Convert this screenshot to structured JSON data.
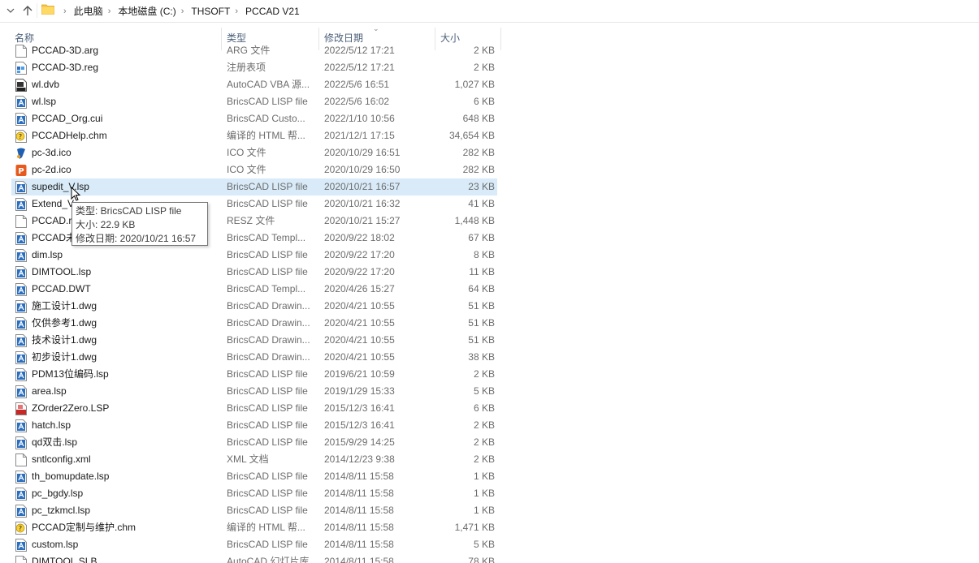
{
  "address": {
    "crumbs": [
      "此电脑",
      "本地磁盘 (C:)",
      "THSOFT",
      "PCCAD V21"
    ]
  },
  "columns": {
    "name": "名称",
    "type": "类型",
    "date": "修改日期",
    "size": "大小"
  },
  "files": [
    {
      "name": "PCCAD-3D.arg",
      "type": "ARG 文件",
      "date": "2022/5/12 17:21",
      "size": "2 KB",
      "icon": "generic-file-icon"
    },
    {
      "name": "PCCAD-3D.reg",
      "type": "注册表项",
      "date": "2022/5/12 17:21",
      "size": "2 KB",
      "icon": "registry-icon"
    },
    {
      "name": "wl.dvb",
      "type": "AutoCAD VBA 源...",
      "date": "2022/5/6 16:51",
      "size": "1,027 KB",
      "icon": "dvb-icon"
    },
    {
      "name": "wl.lsp",
      "type": "BricsCAD LISP file",
      "date": "2022/5/6 16:02",
      "size": "6 KB",
      "icon": "bricscad-icon"
    },
    {
      "name": "PCCAD_Org.cui",
      "type": "BricsCAD Custo...",
      "date": "2022/1/10 10:56",
      "size": "648 KB",
      "icon": "bricscad-icon"
    },
    {
      "name": "PCCADHelp.chm",
      "type": "编译的 HTML 帮...",
      "date": "2021/12/1 17:15",
      "size": "34,654 KB",
      "icon": "chm-help-icon"
    },
    {
      "name": "pc-3d.ico",
      "type": "ICO 文件",
      "date": "2020/10/29 16:51",
      "size": "282 KB",
      "icon": "pc3d-ico-icon"
    },
    {
      "name": "pc-2d.ico",
      "type": "ICO 文件",
      "date": "2020/10/29 16:50",
      "size": "282 KB",
      "icon": "pc2d-ico-icon"
    },
    {
      "name": "supedit_V.lsp",
      "type": "BricsCAD LISP file",
      "date": "2020/10/21 16:57",
      "size": "23 KB",
      "icon": "bricscad-icon",
      "selected": true
    },
    {
      "name": "Extend_V",
      "type": "BricsCAD LISP file",
      "date": "2020/10/21 16:32",
      "size": "41 KB",
      "icon": "bricscad-icon"
    },
    {
      "name": "PCCAD.r",
      "type": "RESZ 文件",
      "date": "2020/10/21 15:27",
      "size": "1,448 KB",
      "icon": "generic-file-icon"
    },
    {
      "name": "PCCAD未",
      "type": "BricsCAD Templ...",
      "date": "2020/9/22 18:02",
      "size": "67 KB",
      "icon": "bricscad-icon"
    },
    {
      "name": "dim.lsp",
      "type": "BricsCAD LISP file",
      "date": "2020/9/22 17:20",
      "size": "8 KB",
      "icon": "bricscad-icon"
    },
    {
      "name": "DIMTOOL.lsp",
      "type": "BricsCAD LISP file",
      "date": "2020/9/22 17:20",
      "size": "11 KB",
      "icon": "bricscad-icon"
    },
    {
      "name": "PCCAD.DWT",
      "type": "BricsCAD Templ...",
      "date": "2020/4/26 15:27",
      "size": "64 KB",
      "icon": "bricscad-icon"
    },
    {
      "name": "施工设计1.dwg",
      "type": "BricsCAD Drawin...",
      "date": "2020/4/21 10:55",
      "size": "51 KB",
      "icon": "bricscad-icon"
    },
    {
      "name": "仅供参考1.dwg",
      "type": "BricsCAD Drawin...",
      "date": "2020/4/21 10:55",
      "size": "51 KB",
      "icon": "bricscad-icon"
    },
    {
      "name": "技术设计1.dwg",
      "type": "BricsCAD Drawin...",
      "date": "2020/4/21 10:55",
      "size": "51 KB",
      "icon": "bricscad-icon"
    },
    {
      "name": "初步设计1.dwg",
      "type": "BricsCAD Drawin...",
      "date": "2020/4/21 10:55",
      "size": "38 KB",
      "icon": "bricscad-icon"
    },
    {
      "name": "PDM13位编码.lsp",
      "type": "BricsCAD LISP file",
      "date": "2019/6/21 10:59",
      "size": "2 KB",
      "icon": "bricscad-icon"
    },
    {
      "name": "area.lsp",
      "type": "BricsCAD LISP file",
      "date": "2019/1/29 15:33",
      "size": "5 KB",
      "icon": "bricscad-icon"
    },
    {
      "name": "ZOrder2Zero.LSP",
      "type": "BricsCAD LISP file",
      "date": "2015/12/3 16:41",
      "size": "6 KB",
      "icon": "lsp-red-icon"
    },
    {
      "name": "hatch.lsp",
      "type": "BricsCAD LISP file",
      "date": "2015/12/3 16:41",
      "size": "2 KB",
      "icon": "bricscad-icon"
    },
    {
      "name": "qd双击.lsp",
      "type": "BricsCAD LISP file",
      "date": "2015/9/29 14:25",
      "size": "2 KB",
      "icon": "bricscad-icon"
    },
    {
      "name": "sntlconfig.xml",
      "type": "XML 文档",
      "date": "2014/12/23 9:38",
      "size": "2 KB",
      "icon": "generic-file-icon"
    },
    {
      "name": "th_bomupdate.lsp",
      "type": "BricsCAD LISP file",
      "date": "2014/8/11 15:58",
      "size": "1 KB",
      "icon": "bricscad-icon"
    },
    {
      "name": "pc_bgdy.lsp",
      "type": "BricsCAD LISP file",
      "date": "2014/8/11 15:58",
      "size": "1 KB",
      "icon": "bricscad-icon"
    },
    {
      "name": "pc_tzkmcl.lsp",
      "type": "BricsCAD LISP file",
      "date": "2014/8/11 15:58",
      "size": "1 KB",
      "icon": "bricscad-icon"
    },
    {
      "name": "PCCAD定制与维护.chm",
      "type": "编译的 HTML 帮...",
      "date": "2014/8/11 15:58",
      "size": "1,471 KB",
      "icon": "chm-help-icon"
    },
    {
      "name": "custom.lsp",
      "type": "BricsCAD LISP file",
      "date": "2014/8/11 15:58",
      "size": "5 KB",
      "icon": "bricscad-icon"
    },
    {
      "name": "DIMTOOL.SLB",
      "type": "AutoCAD 幻灯片库",
      "date": "2014/8/11 15:58",
      "size": "78 KB",
      "icon": "generic-file-icon"
    }
  ],
  "tooltip": {
    "type_line": "类型: BricsCAD LISP file",
    "size_line": "大小: 22.9 KB",
    "date_line": "修改日期: 2020/10/21 16:57"
  },
  "colors": {
    "selected_row": "#d9ebf9",
    "header_text": "#4c607a",
    "secondary_text": "#6d6d6d",
    "bricscad_blue": "#2b6fc0",
    "folder_yellow": "#f4c542"
  }
}
